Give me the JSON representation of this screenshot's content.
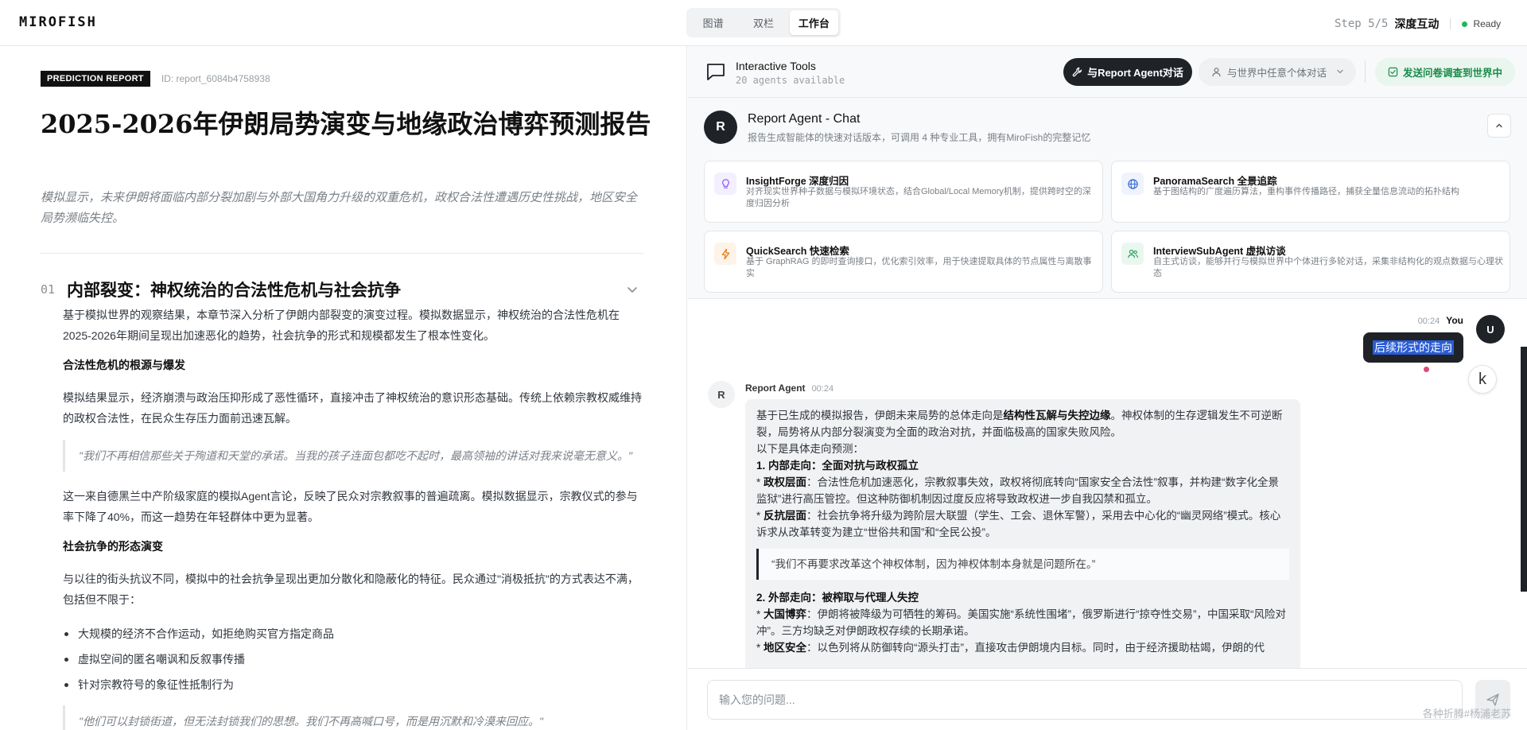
{
  "app": {
    "brand": "MIROFISH"
  },
  "view_tabs": [
    {
      "label": "图谱",
      "active": false
    },
    {
      "label": "双栏",
      "active": false
    },
    {
      "label": "工作台",
      "active": true
    }
  ],
  "step": {
    "label": "Step 5/5",
    "name": "深度互动",
    "status": "Ready"
  },
  "report": {
    "badge": "PREDICTION REPORT",
    "id": "ID: report_6084b4758938",
    "title": "2025-2026年伊朗局势演变与地缘政治博弈预测报告",
    "summary": "模拟显示，未来伊朗将面临内部分裂加剧与外部大国角力升级的双重危机，政权合法性遭遇历史性挑战，地区安全局势濒临失控。",
    "section": {
      "number": "01",
      "title": "内部裂变：神权统治的合法性危机与社会抗争",
      "p1": "基于模拟世界的观察结果，本章节深入分析了伊朗内部裂变的演变过程。模拟数据显示，神权统治的合法性危机在2025-2026年期间呈现出加速恶化的趋势，社会抗争的形式和规模都发生了根本性变化。",
      "h1": "合法性危机的根源与爆发",
      "p2": "模拟结果显示，经济崩溃与政治压抑形成了恶性循环，直接冲击了神权统治的意识形态基础。传统上依赖宗教权威维持的政权合法性，在民众生存压力面前迅速瓦解。",
      "q1": "\"我们不再相信那些关于殉道和天堂的承诺。当我的孩子连面包都吃不起时，最高领袖的讲话对我来说毫无意义。\"",
      "p3": "这一来自德黑兰中产阶级家庭的模拟Agent言论，反映了民众对宗教叙事的普遍疏离。模拟数据显示，宗教仪式的参与率下降了40%，而这一趋势在年轻群体中更为显著。",
      "h2": "社会抗争的形态演变",
      "p4": "与以往的街头抗议不同，模拟中的社会抗争呈现出更加分散化和隐蔽化的特征。民众通过\"消极抵抗\"的方式表达不满，包括但不限于：",
      "bullets": [
        "大规模的经济不合作运动，如拒绝购买官方指定商品",
        "虚拟空间的匿名嘲讽和反叙事传播",
        "针对宗教符号的象征性抵制行为"
      ],
      "q2": "\"他们可以封锁街道，但无法封锁我们的思想。我们不再高喊口号，而是用沉默和冷漠来回应。\""
    }
  },
  "tools_bar": {
    "title": "Interactive Tools",
    "subtitle": "20 agents available",
    "agent_button": "与Report Agent对话",
    "world_button": "与世界中任意个体对话",
    "survey_button": "发送问卷调查到世界中"
  },
  "agent_card": {
    "avatar": "R",
    "name": "Report Agent - Chat",
    "desc": "报告生成智能体的快速对话版本，可调用 4 种专业工具，拥有MiroFish的完整记忆",
    "tools": [
      {
        "name": "InsightForge 深度归因",
        "desc": "对齐现实世界种子数据与模拟环境状态，结合Global/Local Memory机制，提供跨时空的深度归因分析",
        "icon": "lightbulb-icon",
        "color": "#8b5cf6",
        "bg": "#f3effe"
      },
      {
        "name": "PanoramaSearch 全景追踪",
        "desc": "基于图结构的广度遍历算法，重构事件传播路径，捕获全量信息流动的拓扑结构",
        "icon": "globe-icon",
        "color": "#3b6fd8",
        "bg": "#eef3fd"
      },
      {
        "name": "QuickSearch 快速检索",
        "desc": "基于 GraphRAG 的即时查询接口，优化索引效率，用于快速提取具体的节点属性与离散事实",
        "icon": "lightning-icon",
        "color": "#e8790e",
        "bg": "#fdf3e8"
      },
      {
        "name": "InterviewSubAgent 虚拟访谈",
        "desc": "自主式访谈，能够并行与模拟世界中个体进行多轮对话，采集非结构化的观点数据与心理状态",
        "icon": "users-icon",
        "color": "#1a9a52",
        "bg": "#eaf7ef"
      }
    ]
  },
  "chat": {
    "user": {
      "time": "00:24",
      "name": "You",
      "avatar": "U",
      "message": "后续形式的走向",
      "aside": "k"
    },
    "bot": {
      "avatar": "R",
      "name": "Report Agent",
      "time": "00:24",
      "intro_a": "基于已生成的模拟报告，伊朗未来局势的总体走向是",
      "intro_bold": "结构性瓦解与失控边缘",
      "intro_b": "。神权体制的生存逻辑发生不可逆断裂，局势将从内部分裂演变为全面的政治对抗，并面临极高的国家失败风险。",
      "lead": "以下是具体走向预测：",
      "s1_title": "1. 内部走向：全面对抗与政权孤立",
      "s1_b1_label": "政权层面",
      "s1_b1": "：合法性危机加速恶化，宗教叙事失效，政权将彻底转向“国家安全合法性”叙事，并构建“数字化全景监狱”进行高压管控。但这种防御机制因过度反应将导致政权进一步自我囚禁和孤立。",
      "s1_b2_label": "反抗层面",
      "s1_b2": "：社会抗争将升级为跨阶层大联盟（学生、工会、退休军警），采用去中心化的“幽灵网络”模式。核心诉求从改革转变为建立“世俗共和国”和“全民公投”。",
      "quote": "“我们不再要求改革这个神权体制，因为神权体制本身就是问题所在。”",
      "s2_title": "2. 外部走向：被榨取与代理人失控",
      "s2_b1_label": "大国博弈",
      "s2_b1": "：伊朗将被降级为可牺牲的筹码。美国实施“系统性围堵”，俄罗斯进行“掠夺性交易”，中国采取“风险对冲”。三方均缺乏对伊朗政权存续的长期承诺。",
      "s2_b2_label": "地区安全",
      "s2_b2": "：以色列将从防御转向“源头打击”，直接攻击伊朗境内目标。同时，由于经济援助枯竭，伊朗的代"
    }
  },
  "input": {
    "placeholder": "输入您的问题..."
  },
  "watermark": "各种折腾#杨浦老苏"
}
